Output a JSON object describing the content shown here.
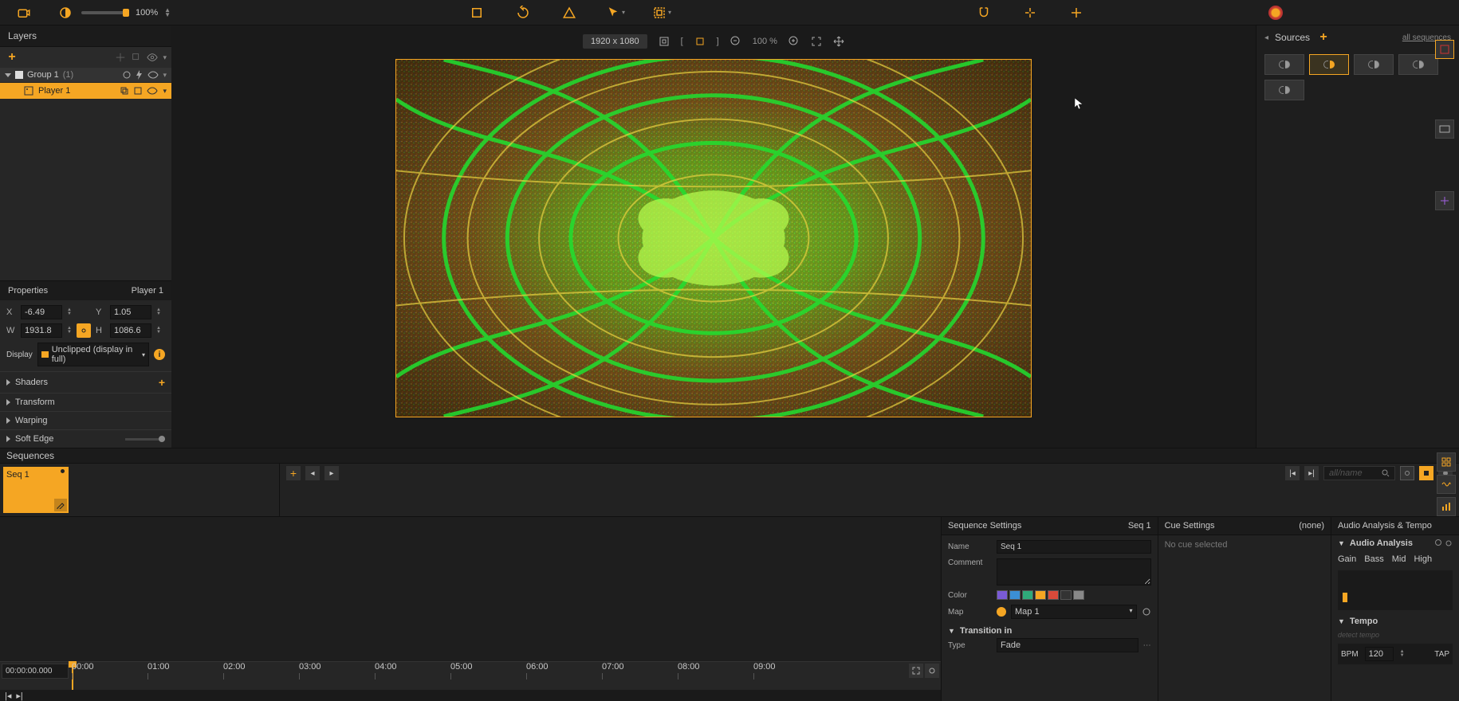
{
  "toolbar": {
    "opacity_value": "100%",
    "opacity_icon": "contrast"
  },
  "canvas": {
    "resolution": "1920 x 1080",
    "zoom": "100 %",
    "bracket_left": "[",
    "bracket_right": "]"
  },
  "layers": {
    "title": "Layers",
    "group": {
      "name": "Group 1",
      "number": "(1)"
    },
    "player": {
      "name": "Player 1"
    }
  },
  "properties": {
    "title": "Properties",
    "selected": "Player 1",
    "x": "-6.49",
    "y": "1.05",
    "w": "1931.8",
    "h": "1086.6",
    "display_label": "Display",
    "display_value": "Unclipped (display in full)",
    "sections": {
      "shaders": "Shaders",
      "transform": "Transform",
      "warping": "Warping",
      "softedge": "Soft Edge"
    }
  },
  "sources": {
    "title": "Sources",
    "link": "all sequences"
  },
  "sequences": {
    "title": "Sequences",
    "tab1": "Seq 1",
    "search_placeholder": "all/name",
    "time": "00:00:00.000",
    "ticks": [
      "00:00",
      "01:00",
      "02:00",
      "03:00",
      "04:00",
      "05:00",
      "06:00",
      "07:00",
      "08:00",
      "09:00"
    ]
  },
  "seq_settings": {
    "title": "Sequence Settings",
    "selected": "Seq 1",
    "name_label": "Name",
    "name_value": "Seq 1",
    "comment_label": "Comment",
    "color_label": "Color",
    "colors": [
      "#7a5bd6",
      "#3b8fd6",
      "#2faa7a",
      "#f5a623",
      "#d84a3a",
      "#333333",
      "#888888"
    ],
    "map_label": "Map",
    "map_value": "Map 1",
    "transition_title": "Transition in",
    "type_label": "Type",
    "type_value": "Fade"
  },
  "cue_settings": {
    "title": "Cue Settings",
    "selected": "(none)",
    "empty": "No cue selected"
  },
  "audio": {
    "title": "Audio Analysis & Tempo",
    "analysis": "Audio Analysis",
    "bands": [
      "Gain",
      "Bass",
      "Mid",
      "High"
    ],
    "tempo": "Tempo",
    "detect": "detect tempo",
    "bpm_label": "BPM",
    "bpm_value": "120",
    "tap": "TAP"
  }
}
